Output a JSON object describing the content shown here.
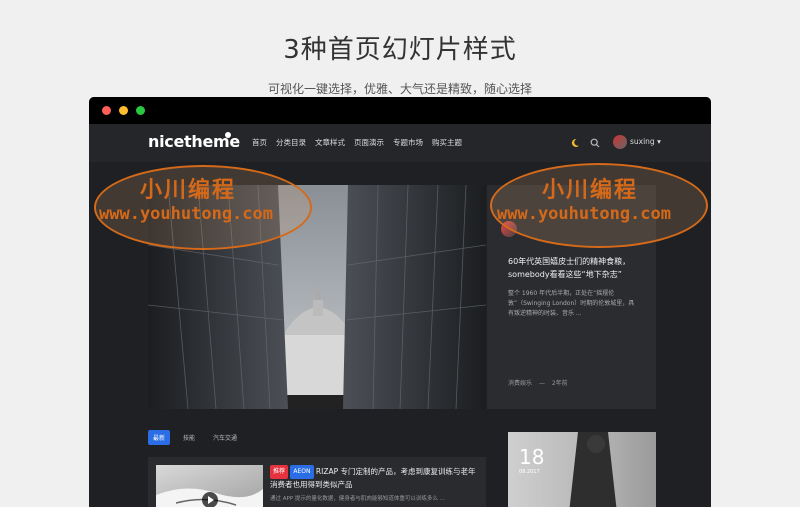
{
  "heading": {
    "title": "3种首页幻灯片样式",
    "subtitle": "可视化一键选择，优雅、大气还是精致，随心选择"
  },
  "site": {
    "logo": "nicetheme",
    "nav": [
      "首页",
      "分类目录",
      "文章样式",
      "页面演示",
      "专题市场",
      "购买主题"
    ],
    "user": "suxing ▾"
  },
  "featured": {
    "title": "60年代英国嬉皮士们的精神食粮，somebody看看这些“地下杂志”",
    "excerpt": "整个 1960 年代后半期，正处在“摇摆伦敦”（Swinging London）时期的伦敦城里，具有叛逆精神的时装、音乐 ...",
    "category": "消费娱乐",
    "time": "2年前"
  },
  "tabs": [
    "最新",
    "技能",
    "汽车交通"
  ],
  "article": {
    "badges": [
      "推荐",
      "AEON"
    ],
    "title": "RIZAP 专门定制的产品，考虑到康复训练与老年消费者也用得到类似产品",
    "excerpt": "通过 APP 提示的量化数据，健身者与肌肉能够知道体重可以训练多么 ..."
  },
  "promo": {
    "day": "18",
    "date": "08.2017"
  },
  "watermark": {
    "cn": "小川编程",
    "url": "www.youhutong.com"
  }
}
